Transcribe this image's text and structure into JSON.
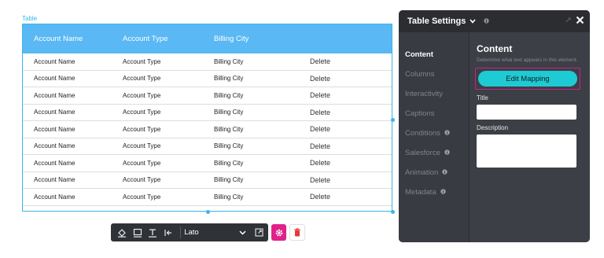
{
  "table": {
    "tag": "Table",
    "headers": [
      "Account Name",
      "Account Type",
      "Billing City"
    ],
    "rows": [
      [
        "Account Name",
        "Account Type",
        "Billing City",
        "Delete"
      ],
      [
        "Account Name",
        "Account Type",
        "Billing City",
        "Delete"
      ],
      [
        "Account Name",
        "Account Type",
        "Billing City",
        "Delete"
      ],
      [
        "Account Name",
        "Account Type",
        "Billing City",
        "Delete"
      ],
      [
        "Account Name",
        "Account Type",
        "Billing City",
        "Delete"
      ],
      [
        "Account Name",
        "Account Type",
        "Billing City",
        "Delete"
      ],
      [
        "Account Name",
        "Account Type",
        "Billing City",
        "Delete"
      ],
      [
        "Account Name",
        "Account Type",
        "Billing City",
        "Delete"
      ],
      [
        "Account Name",
        "Account Type",
        "Billing City",
        "Delete"
      ]
    ]
  },
  "toolbar": {
    "icons": [
      "fill-color-icon",
      "border-icon",
      "text-icon",
      "align-left-icon"
    ],
    "font": "Lato",
    "gear_icon": "gear-icon",
    "trash_icon": "trash-icon"
  },
  "panel": {
    "title": "Table Settings",
    "nav": [
      {
        "label": "Content",
        "active": true,
        "info": false
      },
      {
        "label": "Columns",
        "active": false,
        "info": false
      },
      {
        "label": "Interactivity",
        "active": false,
        "info": false
      },
      {
        "label": "Captions",
        "active": false,
        "info": false
      },
      {
        "label": "Conditions",
        "active": false,
        "info": true
      },
      {
        "label": "Salesforce",
        "active": false,
        "info": true
      },
      {
        "label": "Animation",
        "active": false,
        "info": true
      },
      {
        "label": "Metadata",
        "active": false,
        "info": true
      }
    ],
    "content": {
      "title": "Content",
      "description": "Determine what text appears in this element.",
      "mapping_button": "Edit Mapping",
      "title_label": "Title",
      "description_label": "Description"
    }
  },
  "colors": {
    "header_bg": "#5ab8f4",
    "accent_teal": "#1ecad3",
    "accent_magenta": "#e0218a",
    "panel_bg": "#3c3f45"
  }
}
